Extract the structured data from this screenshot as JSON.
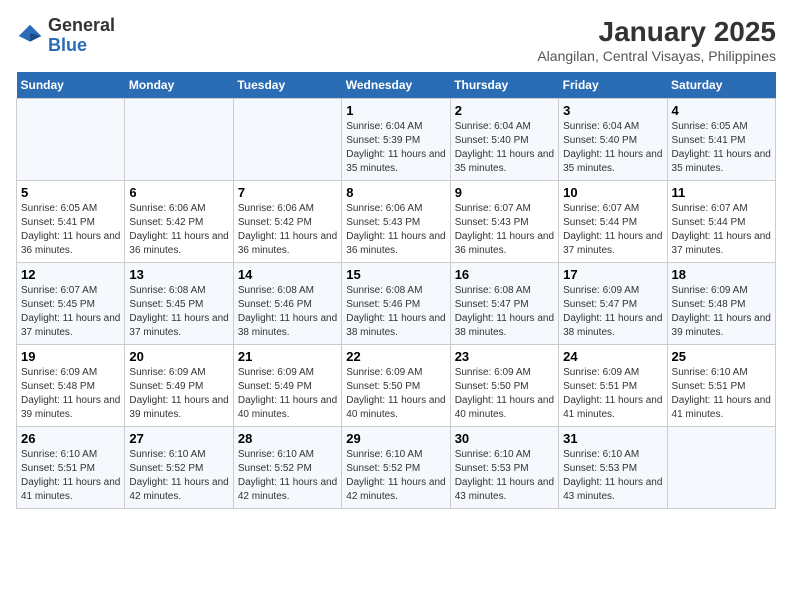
{
  "header": {
    "logo_general": "General",
    "logo_blue": "Blue",
    "main_title": "January 2025",
    "subtitle": "Alangilan, Central Visayas, Philippines"
  },
  "days_of_week": [
    "Sunday",
    "Monday",
    "Tuesday",
    "Wednesday",
    "Thursday",
    "Friday",
    "Saturday"
  ],
  "weeks": [
    [
      {
        "day": "",
        "info": ""
      },
      {
        "day": "",
        "info": ""
      },
      {
        "day": "",
        "info": ""
      },
      {
        "day": "1",
        "info": "Sunrise: 6:04 AM\nSunset: 5:39 PM\nDaylight: 11 hours and 35 minutes."
      },
      {
        "day": "2",
        "info": "Sunrise: 6:04 AM\nSunset: 5:40 PM\nDaylight: 11 hours and 35 minutes."
      },
      {
        "day": "3",
        "info": "Sunrise: 6:04 AM\nSunset: 5:40 PM\nDaylight: 11 hours and 35 minutes."
      },
      {
        "day": "4",
        "info": "Sunrise: 6:05 AM\nSunset: 5:41 PM\nDaylight: 11 hours and 35 minutes."
      }
    ],
    [
      {
        "day": "5",
        "info": "Sunrise: 6:05 AM\nSunset: 5:41 PM\nDaylight: 11 hours and 36 minutes."
      },
      {
        "day": "6",
        "info": "Sunrise: 6:06 AM\nSunset: 5:42 PM\nDaylight: 11 hours and 36 minutes."
      },
      {
        "day": "7",
        "info": "Sunrise: 6:06 AM\nSunset: 5:42 PM\nDaylight: 11 hours and 36 minutes."
      },
      {
        "day": "8",
        "info": "Sunrise: 6:06 AM\nSunset: 5:43 PM\nDaylight: 11 hours and 36 minutes."
      },
      {
        "day": "9",
        "info": "Sunrise: 6:07 AM\nSunset: 5:43 PM\nDaylight: 11 hours and 36 minutes."
      },
      {
        "day": "10",
        "info": "Sunrise: 6:07 AM\nSunset: 5:44 PM\nDaylight: 11 hours and 37 minutes."
      },
      {
        "day": "11",
        "info": "Sunrise: 6:07 AM\nSunset: 5:44 PM\nDaylight: 11 hours and 37 minutes."
      }
    ],
    [
      {
        "day": "12",
        "info": "Sunrise: 6:07 AM\nSunset: 5:45 PM\nDaylight: 11 hours and 37 minutes."
      },
      {
        "day": "13",
        "info": "Sunrise: 6:08 AM\nSunset: 5:45 PM\nDaylight: 11 hours and 37 minutes."
      },
      {
        "day": "14",
        "info": "Sunrise: 6:08 AM\nSunset: 5:46 PM\nDaylight: 11 hours and 38 minutes."
      },
      {
        "day": "15",
        "info": "Sunrise: 6:08 AM\nSunset: 5:46 PM\nDaylight: 11 hours and 38 minutes."
      },
      {
        "day": "16",
        "info": "Sunrise: 6:08 AM\nSunset: 5:47 PM\nDaylight: 11 hours and 38 minutes."
      },
      {
        "day": "17",
        "info": "Sunrise: 6:09 AM\nSunset: 5:47 PM\nDaylight: 11 hours and 38 minutes."
      },
      {
        "day": "18",
        "info": "Sunrise: 6:09 AM\nSunset: 5:48 PM\nDaylight: 11 hours and 39 minutes."
      }
    ],
    [
      {
        "day": "19",
        "info": "Sunrise: 6:09 AM\nSunset: 5:48 PM\nDaylight: 11 hours and 39 minutes."
      },
      {
        "day": "20",
        "info": "Sunrise: 6:09 AM\nSunset: 5:49 PM\nDaylight: 11 hours and 39 minutes."
      },
      {
        "day": "21",
        "info": "Sunrise: 6:09 AM\nSunset: 5:49 PM\nDaylight: 11 hours and 40 minutes."
      },
      {
        "day": "22",
        "info": "Sunrise: 6:09 AM\nSunset: 5:50 PM\nDaylight: 11 hours and 40 minutes."
      },
      {
        "day": "23",
        "info": "Sunrise: 6:09 AM\nSunset: 5:50 PM\nDaylight: 11 hours and 40 minutes."
      },
      {
        "day": "24",
        "info": "Sunrise: 6:09 AM\nSunset: 5:51 PM\nDaylight: 11 hours and 41 minutes."
      },
      {
        "day": "25",
        "info": "Sunrise: 6:10 AM\nSunset: 5:51 PM\nDaylight: 11 hours and 41 minutes."
      }
    ],
    [
      {
        "day": "26",
        "info": "Sunrise: 6:10 AM\nSunset: 5:51 PM\nDaylight: 11 hours and 41 minutes."
      },
      {
        "day": "27",
        "info": "Sunrise: 6:10 AM\nSunset: 5:52 PM\nDaylight: 11 hours and 42 minutes."
      },
      {
        "day": "28",
        "info": "Sunrise: 6:10 AM\nSunset: 5:52 PM\nDaylight: 11 hours and 42 minutes."
      },
      {
        "day": "29",
        "info": "Sunrise: 6:10 AM\nSunset: 5:52 PM\nDaylight: 11 hours and 42 minutes."
      },
      {
        "day": "30",
        "info": "Sunrise: 6:10 AM\nSunset: 5:53 PM\nDaylight: 11 hours and 43 minutes."
      },
      {
        "day": "31",
        "info": "Sunrise: 6:10 AM\nSunset: 5:53 PM\nDaylight: 11 hours and 43 minutes."
      },
      {
        "day": "",
        "info": ""
      }
    ]
  ]
}
